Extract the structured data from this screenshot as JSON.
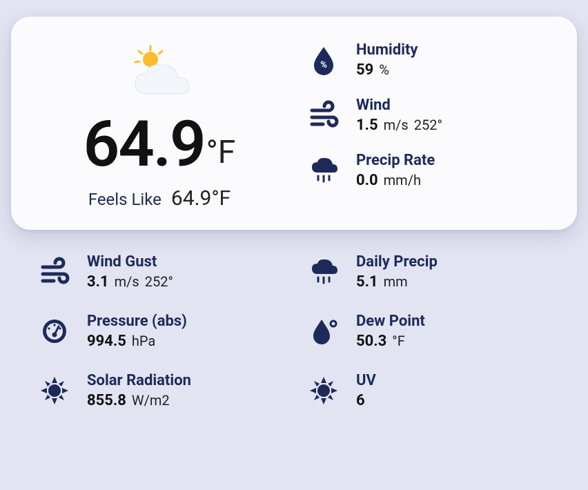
{
  "main": {
    "temperature": "64.9",
    "temperature_unit": "°F",
    "feels_like_label": "Feels Like",
    "feels_like_value": "64.9°F"
  },
  "card_metrics": {
    "humidity": {
      "label": "Humidity",
      "value": "59",
      "unit": "%"
    },
    "wind": {
      "label": "Wind",
      "value": "1.5",
      "unit": "m/s",
      "direction": "252°"
    },
    "precip_rate": {
      "label": "Precip Rate",
      "value": "0.0",
      "unit": "mm/h"
    }
  },
  "lower_metrics": {
    "wind_gust": {
      "label": "Wind Gust",
      "value": "3.1",
      "unit": "m/s",
      "direction": "252°"
    },
    "daily_precip": {
      "label": "Daily Precip",
      "value": "5.1",
      "unit": "mm"
    },
    "pressure": {
      "label": "Pressure (abs)",
      "value": "994.5",
      "unit": "hPa"
    },
    "dew_point": {
      "label": "Dew Point",
      "value": "50.3",
      "unit": "°F"
    },
    "solar_radiation": {
      "label": "Solar Radiation",
      "value": "855.8",
      "unit": "W/m2"
    },
    "uv": {
      "label": "UV",
      "value": "6",
      "unit": ""
    }
  }
}
